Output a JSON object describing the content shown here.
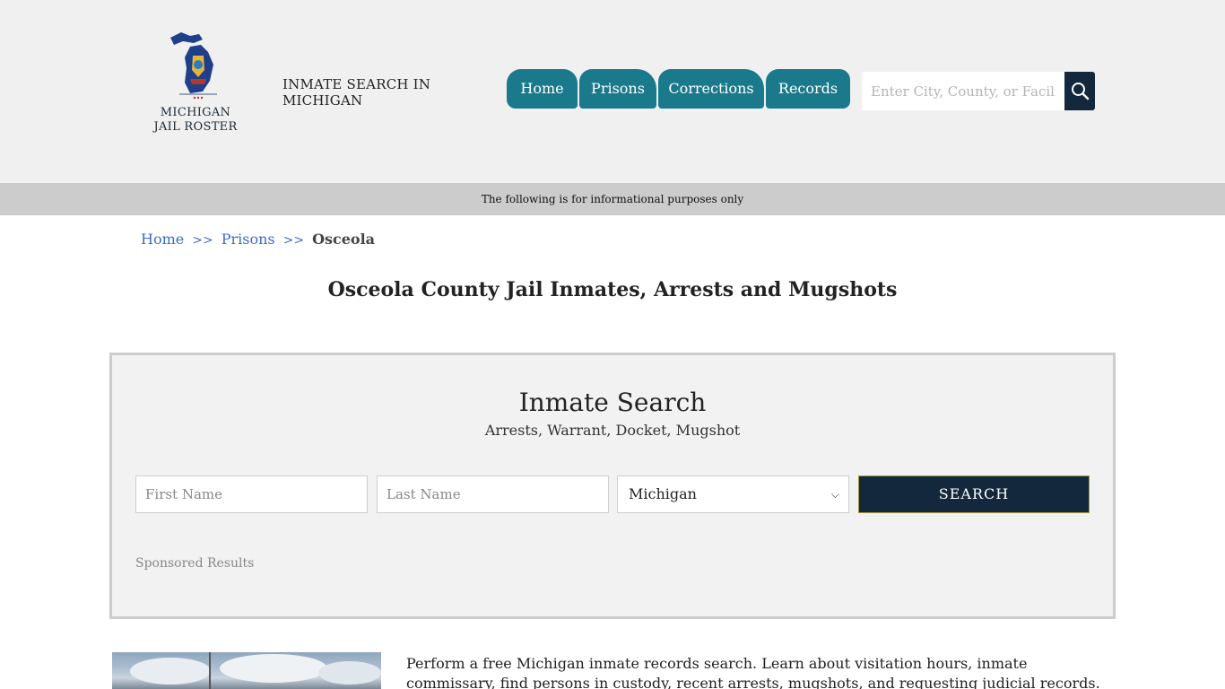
{
  "header": {
    "logo_line1": "MICHIGAN",
    "logo_line2": "JAIL ROSTER",
    "site_title_line1": "INMATE SEARCH IN",
    "site_title_line2": "MICHIGAN"
  },
  "nav": {
    "items": [
      {
        "label": "Home"
      },
      {
        "label": "Prisons"
      },
      {
        "label": "Corrections"
      },
      {
        "label": "Records"
      }
    ]
  },
  "search": {
    "placeholder": "Enter City, County, or Facility",
    "button_icon": "search-icon"
  },
  "info_bar": {
    "text": "The following is for informational purposes only"
  },
  "breadcrumb": {
    "home": "Home",
    "sep1": ">>",
    "prisons": "Prisons",
    "sep2": ">>",
    "current": "Osceola"
  },
  "page": {
    "title": "Osceola County Jail Inmates, Arrests and Mugshots"
  },
  "inmate_search": {
    "title": "Inmate Search",
    "subtitle": "Arrests, Warrant, Docket, Mugshot",
    "first_name_placeholder": "First Name",
    "last_name_placeholder": "Last Name",
    "state_selected": "Michigan",
    "submit_label": "SEARCH",
    "sponsored": "Sponsored Results"
  },
  "content": {
    "intro": "Perform a free Michigan inmate records search. Learn about visitation hours, inmate commissary, find persons in custody, recent arrests, mugshots, and requesting judicial records."
  },
  "colors": {
    "nav_bg": "#1a7a8c",
    "dark_navy": "#13283d",
    "link_blue": "#3a6bc8",
    "header_bg": "#f0f0f0",
    "info_bar_bg": "#cccccc"
  }
}
